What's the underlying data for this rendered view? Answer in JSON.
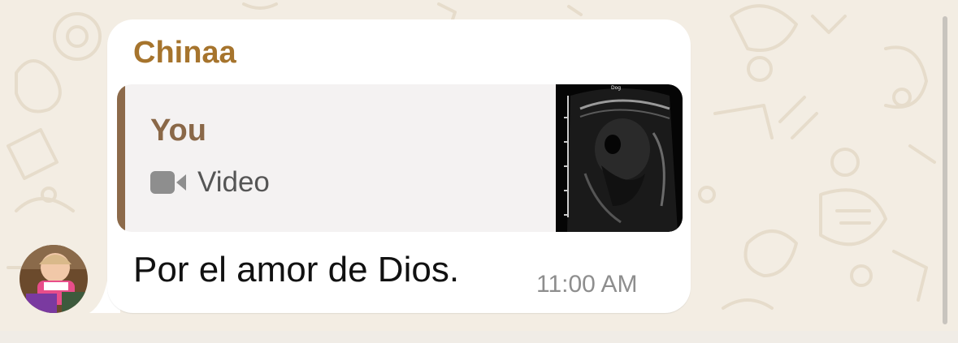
{
  "message": {
    "sender_name": "Chinaa",
    "sender_color": "#a6742d",
    "quote": {
      "author": "You",
      "media_icon": "video-camera-icon",
      "media_label": "Video",
      "thumbnail_caption": "Dog"
    },
    "text": "Por el amor de Dios.",
    "time": "11:00 AM"
  },
  "colors": {
    "wallpaper": "#f3ede3",
    "bubble": "#ffffff",
    "quote_bar": "#8c6a4a",
    "quote_background": "#f4f2f2"
  }
}
